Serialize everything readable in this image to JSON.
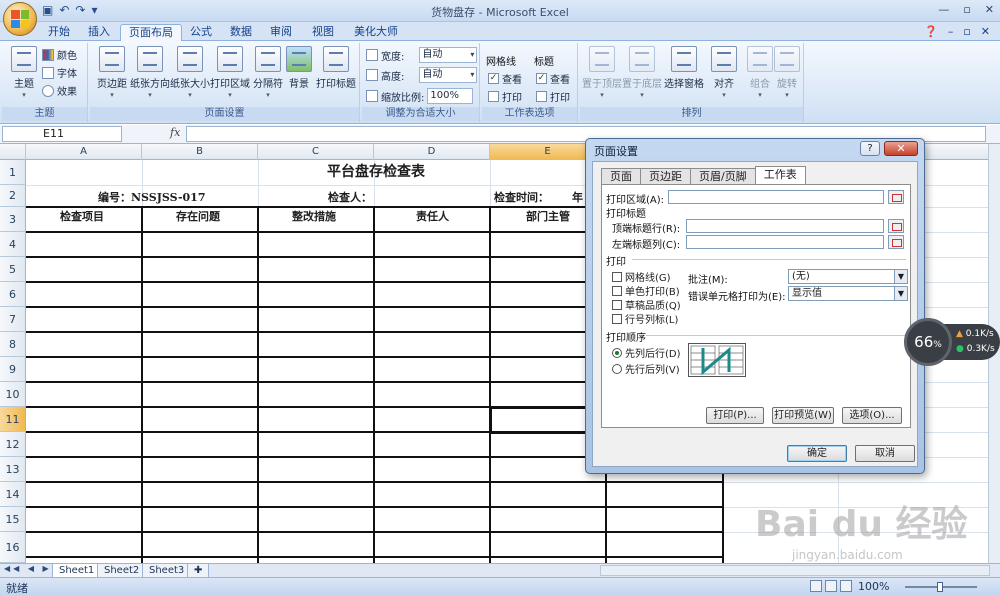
{
  "window": {
    "title": "货物盘存 - Microsoft Excel",
    "controls": [
      "—",
      "▫",
      "✕"
    ]
  },
  "ribbon_tabs": [
    "开始",
    "插入",
    "页面布局",
    "公式",
    "数据",
    "审阅",
    "视图",
    "美化大师"
  ],
  "active_tab": "页面布局",
  "ribbon": {
    "themes": {
      "label": "主题",
      "big": "主题",
      "colors": "颜色",
      "fonts": "字体",
      "effects": "效果"
    },
    "page_setup": {
      "label": "页面设置",
      "buttons": [
        "页边距",
        "纸张方向",
        "纸张大小",
        "打印区域",
        "分隔符",
        "背景",
        "打印标题"
      ]
    },
    "scale": {
      "label": "调整为合适大小",
      "width_label": "宽度:",
      "width_value": "自动",
      "height_label": "高度:",
      "height_value": "自动",
      "zoom_label": "缩放比例:",
      "zoom_value": "100%"
    },
    "sheet_options": {
      "label": "工作表选项",
      "gridlines": "网格线",
      "headings": "标题",
      "view": "查看",
      "print": "打印"
    },
    "arrange": {
      "label": "排列",
      "buttons": [
        "置于顶层",
        "置于底层",
        "选择窗格",
        "对齐",
        "组合",
        "旋转"
      ]
    }
  },
  "formula_bar": {
    "name_box": "E11",
    "fx": "fx",
    "value": ""
  },
  "columns": [
    "A",
    "B",
    "C",
    "D",
    "E"
  ],
  "rows": [
    "1",
    "2",
    "3",
    "4",
    "5",
    "6",
    "7",
    "8",
    "9",
    "10",
    "11",
    "12",
    "13",
    "14",
    "15",
    "16"
  ],
  "selected_cell": {
    "column": "E",
    "row": "11"
  },
  "sheet": {
    "title": "平台盘存检查表",
    "row2": {
      "number": "编号：NSSJSS-017",
      "inspector": "检查人：",
      "time": "检查时间：",
      "year": "年"
    },
    "headers": [
      "检查项目",
      "存在问题",
      "整改措施",
      "责任人",
      "部门主管"
    ]
  },
  "sheet_tabs": [
    "Sheet1",
    "Sheet2",
    "Sheet3"
  ],
  "status": {
    "text": "就绪",
    "zoom": "100%"
  },
  "dialog": {
    "title": "页面设置",
    "tabs": [
      "页面",
      "页边距",
      "页眉/页脚",
      "工作表"
    ],
    "active_tab": "工作表",
    "print_area": "打印区域(A):",
    "print_titles": "打印标题",
    "top_rows": "顶端标题行(R):",
    "left_cols": "左端标题列(C):",
    "print_section": "打印",
    "gridlines": "网格线(G)",
    "bw": "单色打印(B)",
    "draft": "草稿品质(Q)",
    "row_col_headings": "行号列标(L)",
    "comments_label": "批注(M):",
    "comments_value": "(无)",
    "errors_label": "错误单元格打印为(E):",
    "errors_value": "显示值",
    "order_section": "打印顺序",
    "down_then_over": "先列后行(D)",
    "over_then_down": "先行后列(V)",
    "btn_print": "打印(P)...",
    "btn_preview": "打印预览(W)",
    "btn_options": "选项(O)...",
    "btn_ok": "确定",
    "btn_cancel": "取消",
    "help": "?",
    "close": "✕"
  },
  "network_widget": {
    "percent": "66",
    "unit": "%",
    "up": "0.1K/s",
    "down": "0.3K/s"
  },
  "watermark": {
    "main": "Bai du 经验",
    "sub": "jingyan.baidu.com"
  }
}
